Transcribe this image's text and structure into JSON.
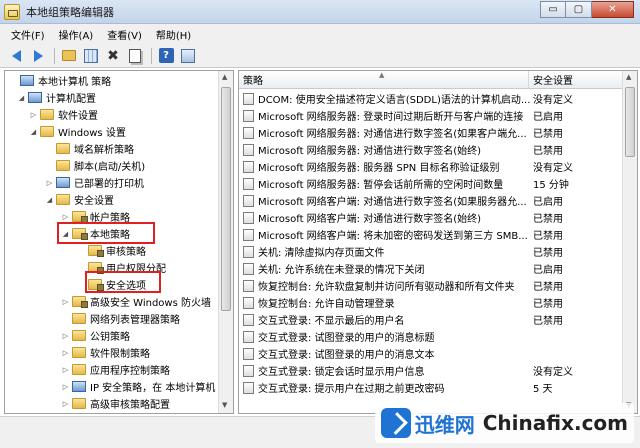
{
  "window": {
    "title": "本地组策略编辑器",
    "min_label": "▭",
    "max_label": "▢",
    "close_label": "✕"
  },
  "menu": [
    "文件(F)",
    "操作(A)",
    "查看(V)",
    "帮助(H)"
  ],
  "toolbar": {
    "help_label": "?"
  },
  "tree": {
    "items": [
      {
        "label": "本地计算机 策略",
        "toggle": ""
      },
      {
        "label": "计算机配置",
        "toggle": "◢"
      },
      {
        "label": "软件设置",
        "toggle": "▷"
      },
      {
        "label": "Windows 设置",
        "toggle": "◢"
      },
      {
        "label": "域名解析策略",
        "toggle": ""
      },
      {
        "label": "脚本(启动/关机)",
        "toggle": ""
      },
      {
        "label": "已部署的打印机",
        "toggle": "▷"
      },
      {
        "label": "安全设置",
        "toggle": "◢"
      },
      {
        "label": "帐户策略",
        "toggle": "▷"
      },
      {
        "label": "本地策略",
        "toggle": "◢"
      },
      {
        "label": "审核策略",
        "toggle": ""
      },
      {
        "label": "用户权限分配",
        "toggle": ""
      },
      {
        "label": "安全选项",
        "toggle": ""
      },
      {
        "label": "高级安全 Windows 防火墙",
        "toggle": "▷"
      },
      {
        "label": "网络列表管理器策略",
        "toggle": ""
      },
      {
        "label": "公钥策略",
        "toggle": "▷"
      },
      {
        "label": "软件限制策略",
        "toggle": "▷"
      },
      {
        "label": "应用程序控制策略",
        "toggle": "▷"
      },
      {
        "label": "IP 安全策略，在 本地计算机",
        "toggle": "▷"
      },
      {
        "label": "高级审核策略配置",
        "toggle": "▷"
      }
    ]
  },
  "list": {
    "columns": {
      "policy": "策略",
      "setting": "安全设置"
    },
    "rows": [
      {
        "policy": "DCOM: 使用安全描述符定义语言(SDDL)语法的计算机启动...",
        "setting": "没有定义"
      },
      {
        "policy": "Microsoft 网络服务器: 登录时间过期后断开与客户端的连接",
        "setting": "已启用"
      },
      {
        "policy": "Microsoft 网络服务器: 对通信进行数字签名(如果客户端允...",
        "setting": "已禁用"
      },
      {
        "policy": "Microsoft 网络服务器: 对通信进行数字签名(始终)",
        "setting": "已禁用"
      },
      {
        "policy": "Microsoft 网络服务器: 服务器 SPN 目标名称验证级别",
        "setting": "没有定义"
      },
      {
        "policy": "Microsoft 网络服务器: 暂停会话前所需的空闲时间数量",
        "setting": "15 分钟"
      },
      {
        "policy": "Microsoft 网络客户端: 对通信进行数字签名(如果服务器允...",
        "setting": "已启用"
      },
      {
        "policy": "Microsoft 网络客户端: 对通信进行数字签名(始终)",
        "setting": "已禁用"
      },
      {
        "policy": "Microsoft 网络客户端: 将未加密的密码发送到第三方 SMB...",
        "setting": "已禁用"
      },
      {
        "policy": "关机: 清除虚拟内存页面文件",
        "setting": "已禁用"
      },
      {
        "policy": "关机: 允许系统在未登录的情况下关闭",
        "setting": "已启用"
      },
      {
        "policy": "恢复控制台: 允许软盘复制并访问所有驱动器和所有文件夹",
        "setting": "已禁用"
      },
      {
        "policy": "恢复控制台: 允许自动管理登录",
        "setting": "已禁用"
      },
      {
        "policy": "交互式登录: 不显示最后的用户名",
        "setting": "已禁用"
      },
      {
        "policy": "交互式登录: 试图登录的用户的消息标题",
        "setting": ""
      },
      {
        "policy": "交互式登录: 试图登录的用户的消息文本",
        "setting": ""
      },
      {
        "policy": "交互式登录: 锁定会话时显示用户信息",
        "setting": "没有定义"
      },
      {
        "policy": "交互式登录: 提示用户在过期之前更改密码",
        "setting": "5 天"
      }
    ]
  },
  "watermark": {
    "cn": "迅维网",
    "en": "Chinafix.com"
  },
  "colors": {
    "highlight": "#e02020",
    "accent": "#1f73d3"
  },
  "icons": [
    "back-arrow-icon",
    "forward-arrow-icon",
    "up-folder-icon",
    "show-hide-tree-icon",
    "delete-icon",
    "properties-icon",
    "help-icon",
    "folder-icon",
    "policy-item-icon"
  ]
}
